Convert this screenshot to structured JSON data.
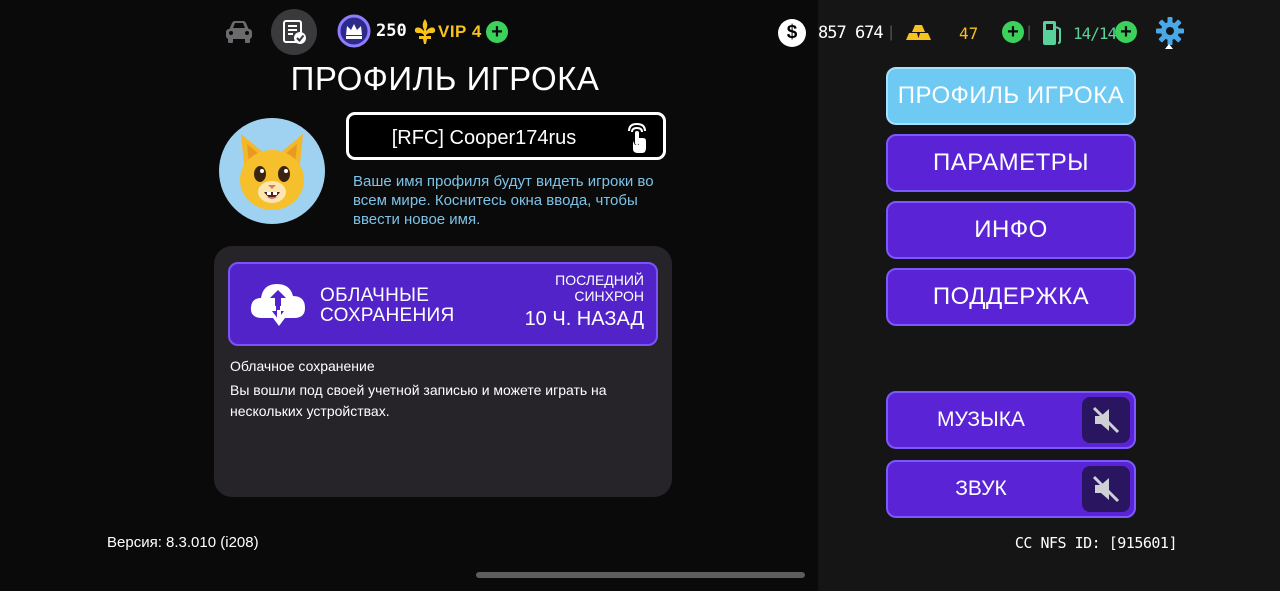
{
  "topbar": {
    "vip_points": "250",
    "vip_level": "VIP 4",
    "cash": "857 674",
    "gold": "47",
    "fuel": "14/14",
    "separator": "|"
  },
  "profile": {
    "title": "ПРОФИЛЬ ИГРОКА",
    "player_name": "[RFC] Cooper174rus",
    "name_hint": "Ваше имя профиля будут видеть игроки во всем мире. Коснитесь окна ввода, чтобы ввести новое имя."
  },
  "cloud": {
    "title_line1": "ОБЛАЧНЫЕ",
    "title_line2": "СОХРАНЕНИЯ",
    "sync_label_line1": "ПОСЛЕДНИЙ",
    "sync_label_line2": "СИНХРОН",
    "sync_value": "10 Ч. НАЗАД",
    "heading": "Облачное сохранение",
    "description": "Вы вошли под своей учетной записью и можете играть на нескольких устройствах."
  },
  "version": "Версия: 8.3.010 (i208)",
  "menu": {
    "items": [
      {
        "label": "ПРОФИЛЬ ИГРОКА",
        "active": true
      },
      {
        "label": "ПАРАМЕТРЫ",
        "active": false
      },
      {
        "label": "ИНФО",
        "active": false
      },
      {
        "label": "ПОДДЕРЖКА",
        "active": false
      }
    ],
    "music_label": "МУЗЫКА",
    "sound_label": "ЗВУК"
  },
  "player_id": "CC NFS ID: [915601]",
  "icons": [
    "car-icon",
    "document-check-icon",
    "crown-icon",
    "fleur-de-lis-icon",
    "plus-icon",
    "dollar-icon",
    "gold-bars-icon",
    "fuel-pump-icon",
    "gear-icon",
    "cat-avatar-icon",
    "tap-hand-icon",
    "cloud-sync-icon",
    "mute-icon"
  ],
  "colors": {
    "accent_purple": "#5a24d6",
    "active_blue": "#6ec9f3",
    "vip_gold": "#f7c21e",
    "plus_green": "#3bd15b",
    "fuel_green": "#58d19a",
    "hint_blue": "#7dc3e8"
  }
}
